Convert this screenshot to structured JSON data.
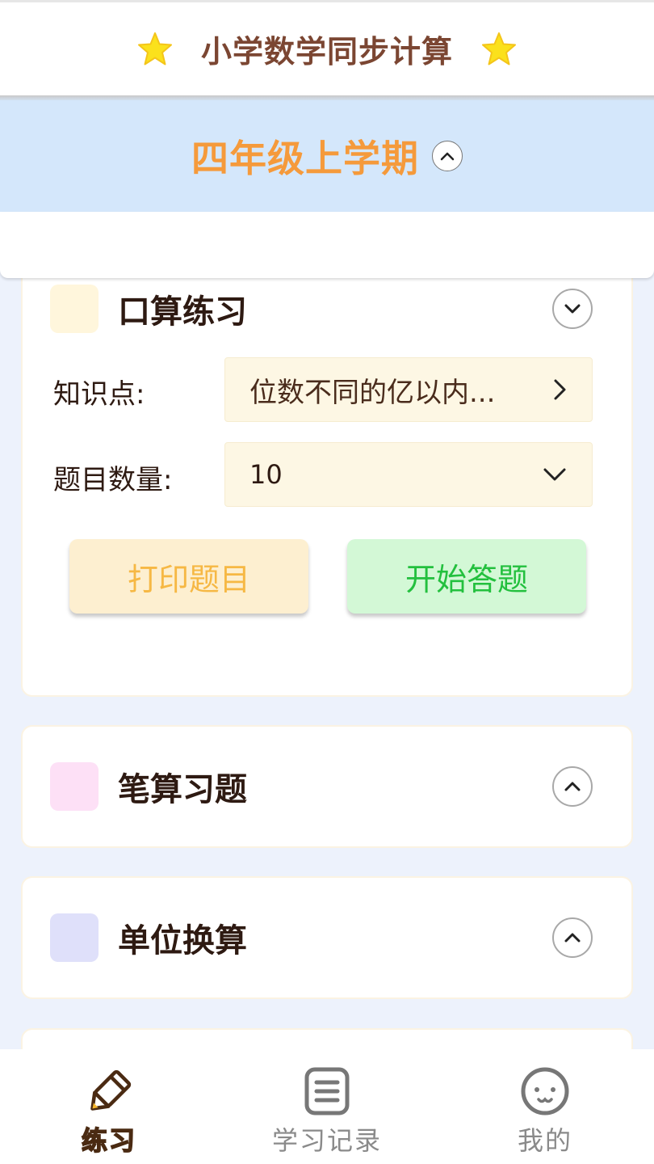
{
  "app": {
    "title": "小学数学同步计算"
  },
  "term": {
    "label": "四年级上学期"
  },
  "oral_practice": {
    "title": "口算练习",
    "knowledge_label": "知识点:",
    "knowledge_value": "位数不同的亿以内...",
    "count_label": "题目数量:",
    "count_value": "10",
    "print_label": "打印题目",
    "start_label": "开始答题"
  },
  "sections": [
    {
      "title": "笔算习题"
    },
    {
      "title": "单位换算"
    }
  ],
  "tabs": [
    {
      "label": "练习",
      "active": true,
      "icon": "pencil-icon"
    },
    {
      "label": "学习记录",
      "active": false,
      "icon": "document-icon"
    },
    {
      "label": "我的",
      "active": false,
      "icon": "face-icon"
    }
  ],
  "colors": {
    "accent_orange": "#f59a3b",
    "term_bar_bg": "#d4e7fb",
    "page_bg": "#edf2fc",
    "oral_icon": "#fff6dc",
    "written_icon": "#fde0f6",
    "unit_icon": "#dfe0fa",
    "print_bg": "#fdefd0",
    "start_bg": "#d3f8d6",
    "start_text": "#23c03e",
    "print_text": "#f6b844",
    "tab_active": "#f5b52c"
  }
}
